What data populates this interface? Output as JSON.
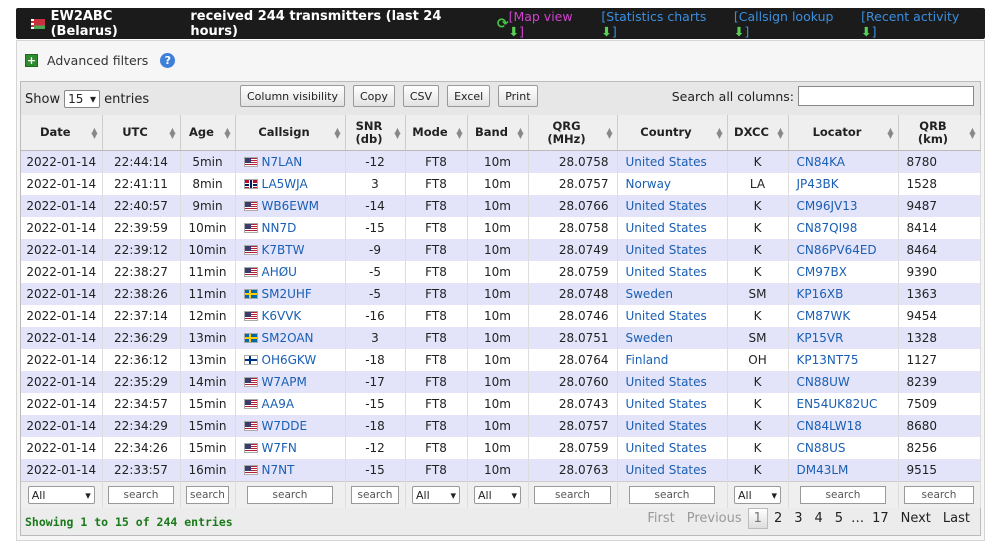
{
  "header": {
    "station": "EW2ABC (Belarus)",
    "received": "received 244 transmitters (last 24 hours)",
    "refresh_glyph": "⟳",
    "links": [
      {
        "label": "[Map view",
        "color": "#d040d0"
      },
      {
        "label": "[Statistics charts",
        "color": "#3a8fe0"
      },
      {
        "label": "[Callsign lookup",
        "color": "#3a8fe0"
      },
      {
        "label": "[Recent activity",
        "color": "#3a8fe0"
      }
    ],
    "link_suffix": "]"
  },
  "advanced_filters": "Advanced filters",
  "toolbar": {
    "show_label": "Show",
    "entries_value": "15",
    "entries_label": "entries",
    "buttons": [
      "Column visibility",
      "Copy",
      "CSV",
      "Excel",
      "Print"
    ],
    "search_label": "Search all columns:",
    "search_value": ""
  },
  "columns": [
    "Date",
    "UTC",
    "Age",
    "Callsign",
    "SNR\n(db)",
    "Mode",
    "Band",
    "QRG\n(MHz)",
    "Country",
    "DXCC",
    "Locator",
    "QRB\n(km)"
  ],
  "rows": [
    {
      "date": "2022-01-14",
      "utc": "22:44:14",
      "age": "5min",
      "flag": "us",
      "call": "N7LAN",
      "snr": "-12",
      "mode": "FT8",
      "band": "10m",
      "qrg": "28.0758",
      "country": "United States",
      "dxcc": "K",
      "locator": "CN84KA",
      "qrb": "8780"
    },
    {
      "date": "2022-01-14",
      "utc": "22:41:11",
      "age": "8min",
      "flag": "no",
      "call": "LA5WJA",
      "snr": "3",
      "mode": "FT8",
      "band": "10m",
      "qrg": "28.0757",
      "country": "Norway",
      "dxcc": "LA",
      "locator": "JP43BK",
      "qrb": "1528"
    },
    {
      "date": "2022-01-14",
      "utc": "22:40:57",
      "age": "9min",
      "flag": "us",
      "call": "WB6EWM",
      "snr": "-14",
      "mode": "FT8",
      "band": "10m",
      "qrg": "28.0766",
      "country": "United States",
      "dxcc": "K",
      "locator": "CM96JV13",
      "qrb": "9487"
    },
    {
      "date": "2022-01-14",
      "utc": "22:39:59",
      "age": "10min",
      "flag": "us",
      "call": "NN7D",
      "snr": "-15",
      "mode": "FT8",
      "band": "10m",
      "qrg": "28.0758",
      "country": "United States",
      "dxcc": "K",
      "locator": "CN87QI98",
      "qrb": "8414"
    },
    {
      "date": "2022-01-14",
      "utc": "22:39:12",
      "age": "10min",
      "flag": "us",
      "call": "K7BTW",
      "snr": "-9",
      "mode": "FT8",
      "band": "10m",
      "qrg": "28.0749",
      "country": "United States",
      "dxcc": "K",
      "locator": "CN86PV64ED",
      "qrb": "8464"
    },
    {
      "date": "2022-01-14",
      "utc": "22:38:27",
      "age": "11min",
      "flag": "us",
      "call": "AHØU",
      "snr": "-5",
      "mode": "FT8",
      "band": "10m",
      "qrg": "28.0759",
      "country": "United States",
      "dxcc": "K",
      "locator": "CM97BX",
      "qrb": "9390"
    },
    {
      "date": "2022-01-14",
      "utc": "22:38:26",
      "age": "11min",
      "flag": "se",
      "call": "SM2UHF",
      "snr": "-5",
      "mode": "FT8",
      "band": "10m",
      "qrg": "28.0748",
      "country": "Sweden",
      "dxcc": "SM",
      "locator": "KP16XB",
      "qrb": "1363"
    },
    {
      "date": "2022-01-14",
      "utc": "22:37:14",
      "age": "12min",
      "flag": "us",
      "call": "K6VVK",
      "snr": "-16",
      "mode": "FT8",
      "band": "10m",
      "qrg": "28.0746",
      "country": "United States",
      "dxcc": "K",
      "locator": "CM87WK",
      "qrb": "9454"
    },
    {
      "date": "2022-01-14",
      "utc": "22:36:29",
      "age": "13min",
      "flag": "se",
      "call": "SM2OAN",
      "snr": "3",
      "mode": "FT8",
      "band": "10m",
      "qrg": "28.0751",
      "country": "Sweden",
      "dxcc": "SM",
      "locator": "KP15VR",
      "qrb": "1328"
    },
    {
      "date": "2022-01-14",
      "utc": "22:36:12",
      "age": "13min",
      "flag": "fi",
      "call": "OH6GKW",
      "snr": "-18",
      "mode": "FT8",
      "band": "10m",
      "qrg": "28.0764",
      "country": "Finland",
      "dxcc": "OH",
      "locator": "KP13NT75",
      "qrb": "1127"
    },
    {
      "date": "2022-01-14",
      "utc": "22:35:29",
      "age": "14min",
      "flag": "us",
      "call": "W7APM",
      "snr": "-17",
      "mode": "FT8",
      "band": "10m",
      "qrg": "28.0760",
      "country": "United States",
      "dxcc": "K",
      "locator": "CN88UW",
      "qrb": "8239"
    },
    {
      "date": "2022-01-14",
      "utc": "22:34:57",
      "age": "15min",
      "flag": "us",
      "call": "AA9A",
      "snr": "-15",
      "mode": "FT8",
      "band": "10m",
      "qrg": "28.0743",
      "country": "United States",
      "dxcc": "K",
      "locator": "EN54UK82UC",
      "qrb": "7509"
    },
    {
      "date": "2022-01-14",
      "utc": "22:34:29",
      "age": "15min",
      "flag": "us",
      "call": "W7DDE",
      "snr": "-18",
      "mode": "FT8",
      "band": "10m",
      "qrg": "28.0757",
      "country": "United States",
      "dxcc": "K",
      "locator": "CN84LW18",
      "qrb": "8680"
    },
    {
      "date": "2022-01-14",
      "utc": "22:34:26",
      "age": "15min",
      "flag": "us",
      "call": "W7FN",
      "snr": "-12",
      "mode": "FT8",
      "band": "10m",
      "qrg": "28.0759",
      "country": "United States",
      "dxcc": "K",
      "locator": "CN88US",
      "qrb": "8256"
    },
    {
      "date": "2022-01-14",
      "utc": "22:33:57",
      "age": "16min",
      "flag": "us",
      "call": "N7NT",
      "snr": "-15",
      "mode": "FT8",
      "band": "10m",
      "qrg": "28.0763",
      "country": "United States",
      "dxcc": "K",
      "locator": "DM43LM",
      "qrb": "9515"
    }
  ],
  "filters": [
    {
      "type": "select",
      "value": "All"
    },
    {
      "type": "input",
      "placeholder": "search"
    },
    {
      "type": "input",
      "placeholder": "search"
    },
    {
      "type": "input",
      "placeholder": "search"
    },
    {
      "type": "input",
      "placeholder": "search"
    },
    {
      "type": "select",
      "value": "All"
    },
    {
      "type": "select",
      "value": "All"
    },
    {
      "type": "input",
      "placeholder": "search"
    },
    {
      "type": "input",
      "placeholder": "search"
    },
    {
      "type": "select",
      "value": "All"
    },
    {
      "type": "input",
      "placeholder": "search"
    },
    {
      "type": "input",
      "placeholder": "search"
    }
  ],
  "info": "Showing 1 to 15 of 244 entries",
  "pagination": {
    "first": "First",
    "previous": "Previous",
    "pages": [
      "1",
      "2",
      "3",
      "4",
      "5"
    ],
    "ellipsis": "…",
    "last_page": "17",
    "next": "Next",
    "last": "Last"
  }
}
